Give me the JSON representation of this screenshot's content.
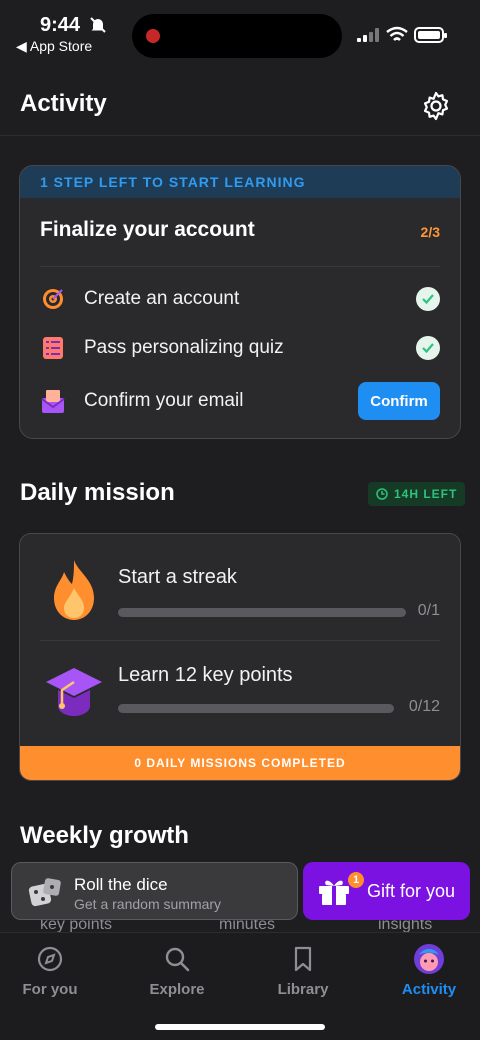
{
  "status_bar": {
    "time": "9:44",
    "back_app": "◀ App Store"
  },
  "header": {
    "title": "Activity"
  },
  "onboarding": {
    "banner": "1 STEP LEFT TO START LEARNING",
    "title": "Finalize your account",
    "progress": "2/3",
    "tasks": [
      {
        "label": "Create an account",
        "done": true,
        "icon": "target-icon"
      },
      {
        "label": "Pass personalizing quiz",
        "done": true,
        "icon": "checklist-icon"
      },
      {
        "label": "Confirm your email",
        "done": false,
        "icon": "envelope-icon",
        "action": "Confirm"
      }
    ]
  },
  "daily_mission": {
    "title": "Daily mission",
    "time_left": "14H LEFT",
    "missions": [
      {
        "label": "Start a streak",
        "progress": 0,
        "count": "0/1",
        "icon": "flame-icon"
      },
      {
        "label": "Learn 12 key points",
        "progress": 0,
        "count": "0/12",
        "icon": "graduation-cap-icon"
      }
    ],
    "footer": "0 DAILY MISSIONS COMPLETED"
  },
  "weekly_growth": {
    "title": "Weekly growth",
    "peek_labels": [
      "key points",
      "minutes",
      "insights"
    ]
  },
  "floating": {
    "dice": {
      "title": "Roll the dice",
      "subtitle": "Get a random summary"
    },
    "gift": {
      "label": "Gift for you",
      "badge": "1"
    }
  },
  "tabs": [
    {
      "label": "For you",
      "icon": "compass-icon",
      "active": false
    },
    {
      "label": "Explore",
      "icon": "search-icon",
      "active": false
    },
    {
      "label": "Library",
      "icon": "bookmark-icon",
      "active": false
    },
    {
      "label": "Activity",
      "icon": "avatar-icon",
      "active": true
    }
  ],
  "colors": {
    "accent_blue": "#1f8ef3",
    "accent_orange": "#ff8f2e",
    "gift_purple": "#7b12e2",
    "success_green": "#2ec27e"
  }
}
